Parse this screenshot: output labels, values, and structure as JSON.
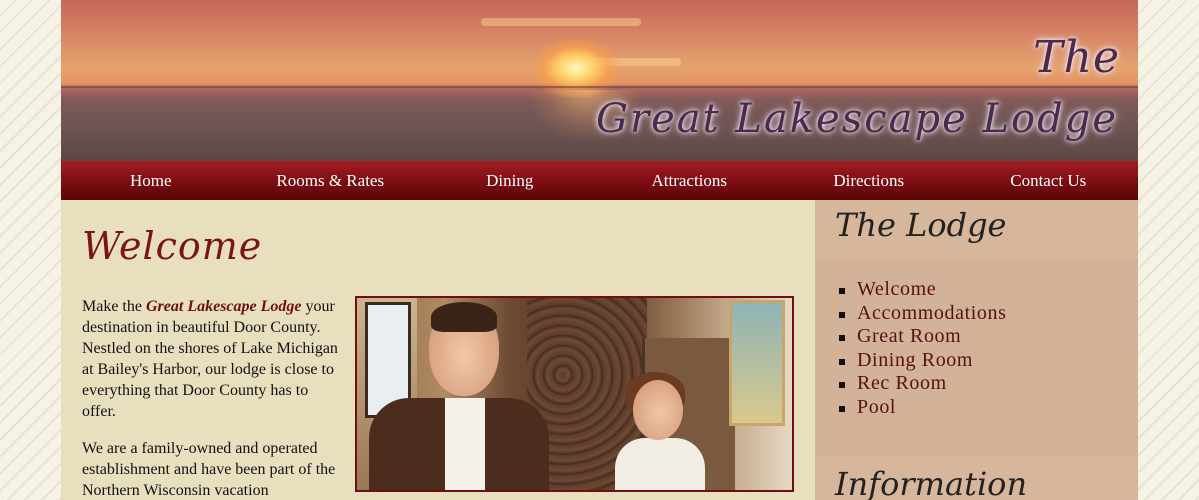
{
  "header": {
    "logo_line1": "The",
    "logo_line2": "Great Lakescape Lodge"
  },
  "nav": {
    "items": [
      {
        "label": "Home"
      },
      {
        "label": "Rooms & Rates"
      },
      {
        "label": "Dining"
      },
      {
        "label": "Attractions"
      },
      {
        "label": "Directions"
      },
      {
        "label": "Contact Us"
      }
    ]
  },
  "main": {
    "heading": "Welcome",
    "para1_prefix": "Make the ",
    "para1_name": "Great Lakescape Lodge",
    "para1_rest": " your destination in beautiful Door County. Nestled on the shores of Lake Michigan at Bailey's Harbor, our lodge is close to everything that Door County has to offer.",
    "para2": "We are a family-owned and operated establishment and have been part of the Northern Wisconsin vacation"
  },
  "sidebar": {
    "title": "The Lodge",
    "items": [
      {
        "label": "Welcome"
      },
      {
        "label": "Accommodations"
      },
      {
        "label": "Great Room"
      },
      {
        "label": "Dining Room"
      },
      {
        "label": "Rec Room"
      },
      {
        "label": "Pool"
      }
    ],
    "title2": "Information"
  },
  "colors": {
    "nav_bg": "#7a0d12",
    "accent": "#6f0f14",
    "content_bg": "#e8dfbf",
    "sidebar_bg": "#d2b39a"
  }
}
